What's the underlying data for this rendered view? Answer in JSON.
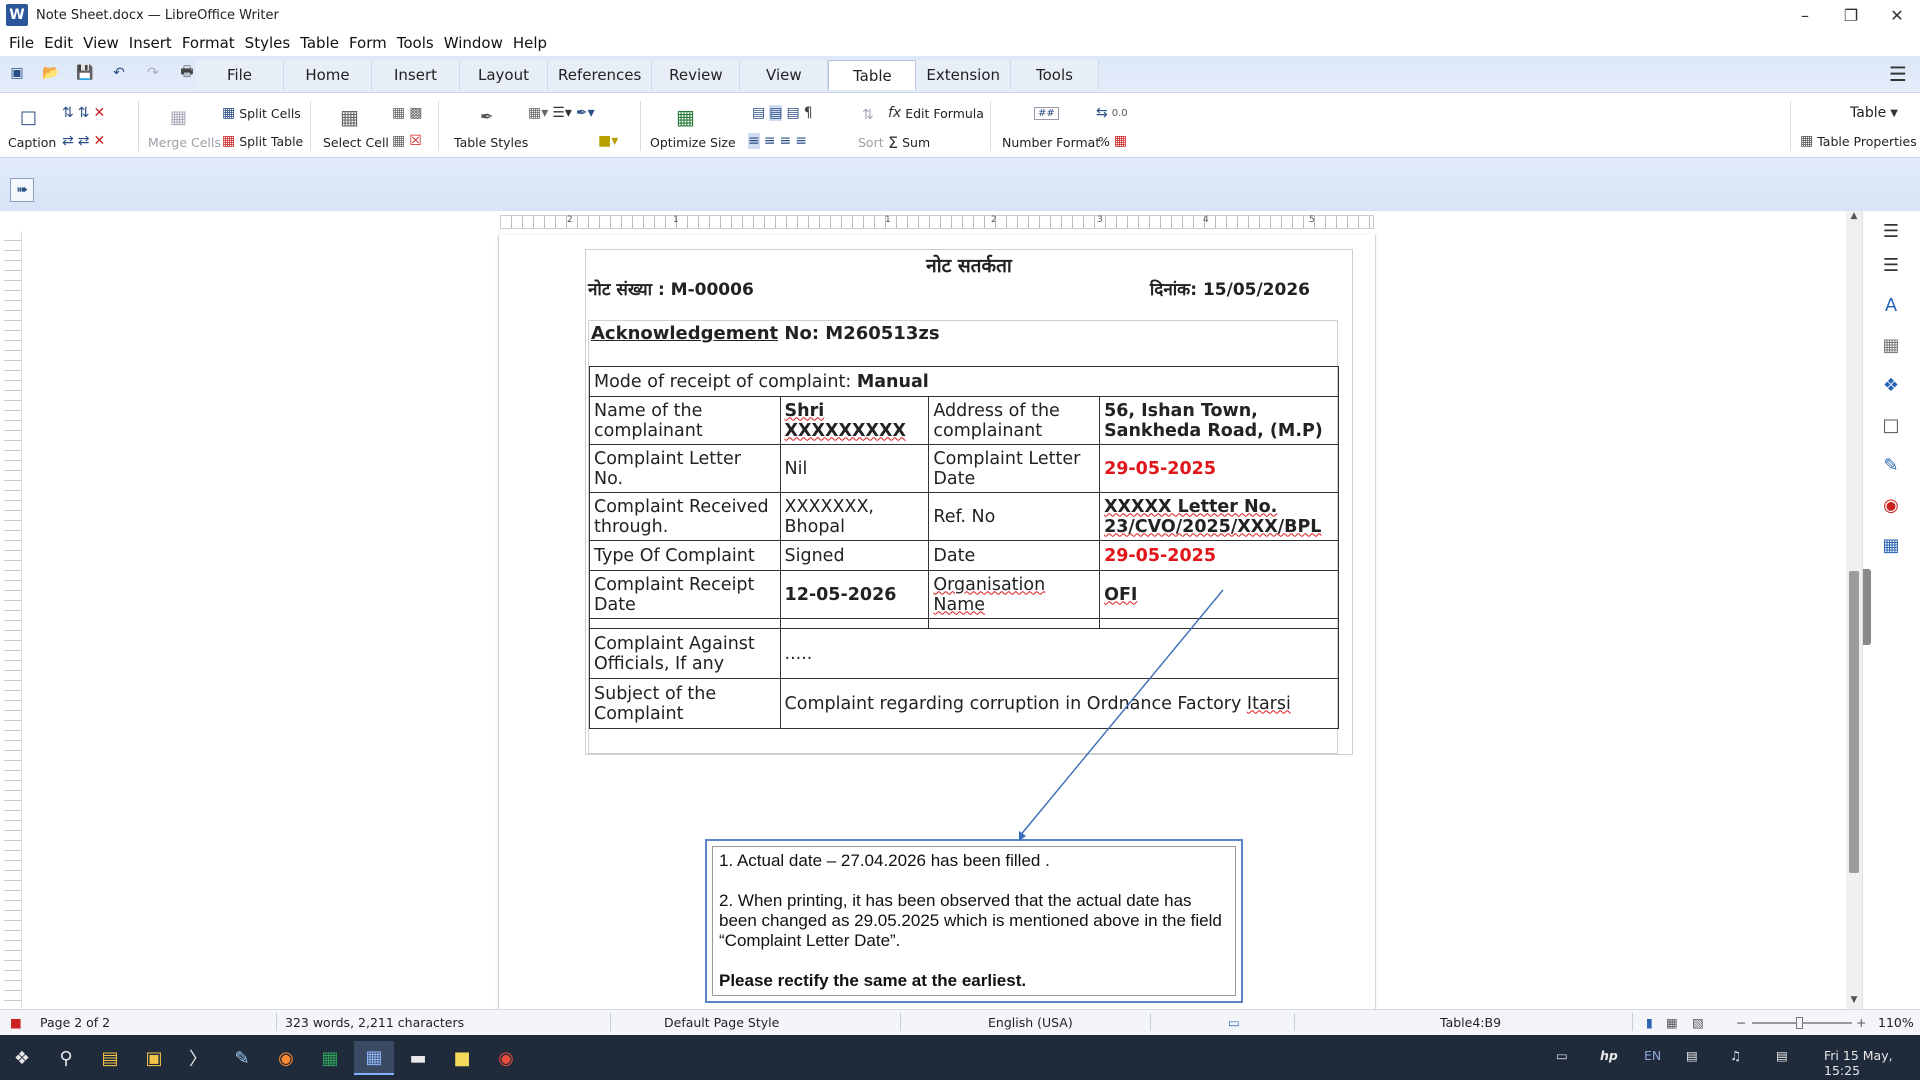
{
  "window": {
    "title": "Note Sheet.docx — LibreOffice Writer",
    "app_icon": "W"
  },
  "menu": [
    "File",
    "Edit",
    "View",
    "Insert",
    "Format",
    "Styles",
    "Table",
    "Form",
    "Tools",
    "Window",
    "Help"
  ],
  "tabs": [
    "File",
    "Home",
    "Insert",
    "Layout",
    "References",
    "Review",
    "View",
    "Table",
    "Extension",
    "Tools"
  ],
  "active_tab": "Table",
  "toolbar": {
    "caption": "Caption",
    "merge_cells": "Merge Cells",
    "split_cells": "Split Cells",
    "split_table": "Split Table",
    "select_cell": "Select Cell",
    "table_styles": "Table Styles",
    "optimize_size": "Optimize Size",
    "sort": "Sort",
    "edit_formula": "Edit Formula",
    "sum": "Sum",
    "number_format": "Number Format",
    "decimal": "0.0",
    "percent": "%",
    "table_dropdown": "Table",
    "table_properties": "Table Properties"
  },
  "document": {
    "note_title": "नोट सतर्कता",
    "note_no_label": "नोट संख्या : M-00006",
    "note_date_label": "दिनांक: 15/05/2026",
    "ack_label": "Acknowledgement",
    "ack_value": " No: M260513zs",
    "mode_label": "Mode of receipt of complaint: ",
    "mode_value": "Manual",
    "rows": {
      "name_label": "Name of the complainant",
      "name_value_1": "Shri",
      "name_value_2": "XXXXXXXXX",
      "address_label": "Address of the complainant",
      "address_value_1": "56, Ishan Town,",
      "address_value_2": "Sankheda Road, (M.P)",
      "letter_no_label": "Complaint Letter No.",
      "letter_no_value": "Nil",
      "letter_date_label": "Complaint Letter Date",
      "letter_date_value": "29-05-2025",
      "received_label": "Complaint Received through.",
      "received_value": "XXXXXXX, Bhopal",
      "ref_label": "Ref. No",
      "ref_value_1": "XXXXX Letter No.",
      "ref_value_2": "23/CVO/2025/XXX/BPL",
      "type_label": "Type Of Complaint",
      "type_value": "Signed",
      "date_label": "Date",
      "date_value": "29-05-2025",
      "receipt_date_label": "Complaint Receipt Date",
      "receipt_date_value": "12-05-2026",
      "org_label": "Organisation Name",
      "org_value": "OFI",
      "against_label": "Complaint Against Officials, If any",
      "against_value": ".....",
      "subject_label": "Subject of the Complaint",
      "subject_value_1": "Complaint regarding corruption in Ordnance Factory ",
      "subject_value_2": "Itarsi"
    },
    "callout": {
      "line1": "1. Actual date – 27.04.2026 has been filled .",
      "line2": "2. When printing, it has been observed that the actual date has been changed as 29.05.2025 which is mentioned above in the field “Complaint Letter Date”.",
      "line3": "Please rectify the same at the earliest."
    }
  },
  "ruler_numbers": [
    "2",
    "1",
    "1",
    "2",
    "3",
    "4",
    "5"
  ],
  "statusbar": {
    "page": "Page 2 of 2",
    "words": "323 words, 2,211 characters",
    "page_style": "Default Page Style",
    "language": "English (USA)",
    "cell": "Table4:B9",
    "zoom": "110%"
  },
  "taskbar": {
    "language": "EN",
    "clock": "Fri 15 May, 15:25"
  },
  "colors": {
    "accent": "#2b579a",
    "red_text": "#e0161b",
    "callout_border": "#5b86c3"
  }
}
